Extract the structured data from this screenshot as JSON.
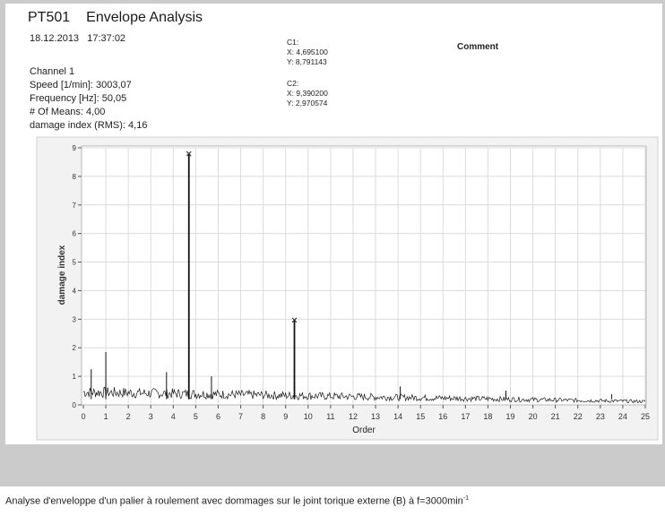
{
  "report": {
    "code": "PT501",
    "name": "Envelope Analysis",
    "date": "18.12.2013",
    "time": "17:37:02",
    "channel": "Channel 1",
    "speed": "Speed [1/min]: 3003,07",
    "frequency": "Frequency [Hz]: 50,05",
    "means": "# Of Means: 4,00",
    "damage_rms": "damage index (RMS): 4,16",
    "comment_label": "Comment"
  },
  "cursors": [
    {
      "label": "C1:",
      "x": "X: 4,695100",
      "y": "Y: 8,791143"
    },
    {
      "label": "C2:",
      "x": "X: 9,390200",
      "y": "Y: 2,970574"
    }
  ],
  "caption": {
    "text": "Analyse d'enveloppe d'un palier à roulement avec dommages sur le joint torique externe (B) à f=3000min",
    "sup": "-1"
  },
  "chart_data": {
    "type": "line",
    "xlabel": "Order",
    "ylabel": "damage index",
    "xlim": [
      0,
      25
    ],
    "ylim": [
      0,
      9
    ],
    "grid": true,
    "x_ticks": [
      "0",
      "1",
      "2",
      "3",
      "4",
      "5",
      "6",
      "7",
      "8",
      "9",
      "10",
      "11",
      "12",
      "13",
      "14",
      "15",
      "16",
      "17",
      "18",
      "19",
      "20",
      "21",
      "22",
      "23",
      "24",
      "25"
    ],
    "y_ticks": [
      "0",
      "1",
      "2",
      "3",
      "4",
      "5",
      "6",
      "7",
      "8",
      "9"
    ],
    "noise_floor": {
      "start": 0.45,
      "end": 0.12
    },
    "peaks": [
      {
        "x": 0.35,
        "y": 1.25
      },
      {
        "x": 1.0,
        "y": 1.85
      },
      {
        "x": 3.7,
        "y": 1.15
      },
      {
        "x": 4.6951,
        "y": 8.791143
      },
      {
        "x": 5.7,
        "y": 1.0
      },
      {
        "x": 9.3902,
        "y": 2.970574
      },
      {
        "x": 14.1,
        "y": 0.65
      },
      {
        "x": 18.8,
        "y": 0.5
      },
      {
        "x": 23.5,
        "y": 0.38
      }
    ],
    "cursor_markers": [
      {
        "x": 4.6951,
        "y": 8.791143
      },
      {
        "x": 9.3902,
        "y": 2.970574
      }
    ]
  }
}
